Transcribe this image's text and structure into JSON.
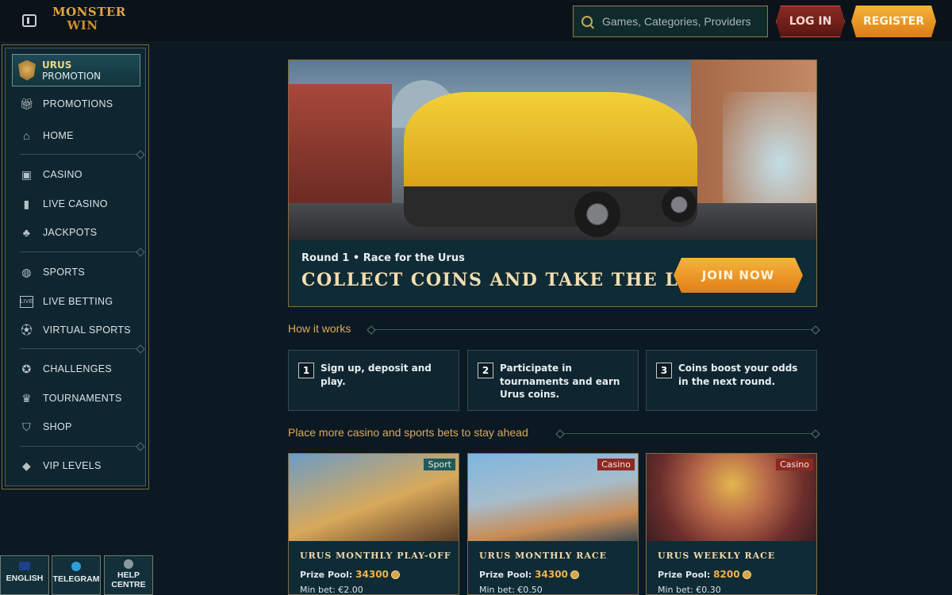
{
  "header": {
    "logo_line1": "MONSTER",
    "logo_line2": "WIN",
    "search_placeholder": "Games, Categories, Providers",
    "login_label": "LOG IN",
    "register_label": "REGISTER"
  },
  "sidebar": {
    "promo": {
      "title": "URUS",
      "subtitle": "PROMOTION"
    },
    "items": [
      {
        "label": "PROMOTIONS",
        "icon": "gift-icon"
      },
      {
        "label": "HOME",
        "icon": "home-icon"
      },
      {
        "label": "CASINO",
        "icon": "slot-machine-icon"
      },
      {
        "label": "LIVE CASINO",
        "icon": "playing-card-icon"
      },
      {
        "label": "JACKPOTS",
        "icon": "clover-icon"
      },
      {
        "label": "SPORTS",
        "icon": "ball-icon"
      },
      {
        "label": "LIVE BETTING",
        "icon": "live-icon"
      },
      {
        "label": "VIRTUAL SPORTS",
        "icon": "virtual-ball-icon"
      },
      {
        "label": "CHALLENGES",
        "icon": "medal-icon"
      },
      {
        "label": "TOURNAMENTS",
        "icon": "trophy-icon"
      },
      {
        "label": "SHOP",
        "icon": "basket-icon"
      },
      {
        "label": "VIP LEVELS",
        "icon": "diamond-icon"
      }
    ]
  },
  "footer": {
    "language": "ENGLISH",
    "telegram": "TELEGRAM",
    "help_line1": "HELP",
    "help_line2": "CENTRE"
  },
  "hero": {
    "caption": "Round 1 • Race for the Urus",
    "title": "COLLECT COINS AND TAKE THE LEAD",
    "cta": "JOIN NOW"
  },
  "how_it_works": {
    "title": "How it works",
    "steps": [
      {
        "num": "1",
        "text": "Sign up, deposit and play."
      },
      {
        "num": "2",
        "text": "Participate in tournaments and earn Urus coins."
      },
      {
        "num": "3",
        "text": "Coins boost your odds in the next round."
      }
    ]
  },
  "bets_section": {
    "title": "Place more casino and sports bets to stay ahead",
    "prize_label": "Prize Pool:",
    "min_label": "Min bet:",
    "cards": [
      {
        "tag": "Sport",
        "name": "URUS MONTHLY PLAY-OFF",
        "prize": "34300",
        "min_bet": "€2.00"
      },
      {
        "tag": "Casino",
        "name": "URUS MONTHLY RACE",
        "prize": "34300",
        "min_bet": "€0.50"
      },
      {
        "tag": "Casino",
        "name": "URUS WEEKLY RACE",
        "prize": "8200",
        "min_bet": "€0.30"
      }
    ]
  },
  "colors": {
    "background": "#0b1a22",
    "accent_orange": "#e8901f",
    "accent_gold": "#e2a75c",
    "login_red": "#8a2b24"
  }
}
